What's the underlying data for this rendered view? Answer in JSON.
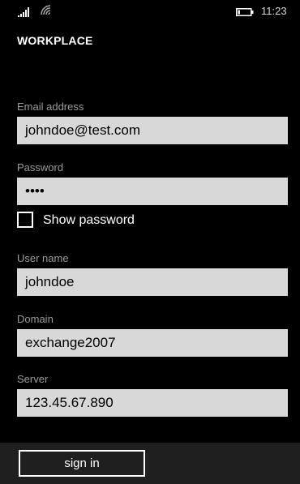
{
  "status_bar": {
    "time": "11:23",
    "signal_icon": "signal-bars-icon",
    "wifi_icon": "wifi-icon",
    "battery_icon": "battery-icon"
  },
  "header": {
    "title": "WORKPLACE"
  },
  "form": {
    "email": {
      "label": "Email address",
      "value": "johndoe@test.com"
    },
    "password": {
      "label": "Password",
      "value": "••••"
    },
    "show_password": {
      "label": "Show password",
      "checked": false
    },
    "username": {
      "label": "User name",
      "value": "johndoe"
    },
    "domain": {
      "label": "Domain",
      "value": "exchange2007"
    },
    "server": {
      "label": "Server",
      "value": "123.45.67.890"
    }
  },
  "app_bar": {
    "sign_in_label": "sign in"
  }
}
